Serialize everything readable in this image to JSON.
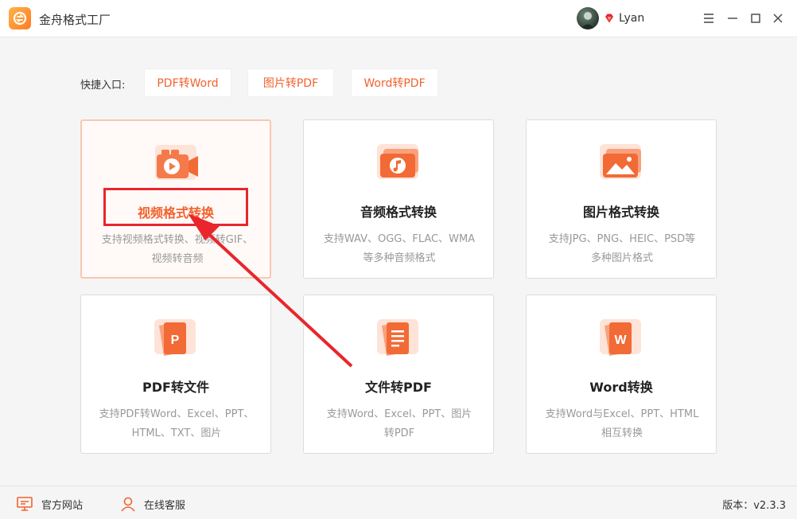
{
  "window": {
    "title": "金舟格式工厂",
    "user_name": "Lyan",
    "controls": [
      "menu-icon",
      "minimize-icon",
      "maximize-icon",
      "close-icon"
    ]
  },
  "quick_entry": {
    "label": "快捷入口:",
    "buttons": [
      "PDF转Word",
      "图片转PDF",
      "Word转PDF"
    ]
  },
  "cards": [
    {
      "title": "视频格式转换",
      "desc_line1": "支持视频格式转换、视频转GIF、",
      "desc_line2": "视频转音频",
      "icon": "video-icon",
      "selected": true
    },
    {
      "title": "音频格式转换",
      "desc_line1": "支持WAV、OGG、FLAC、WMA",
      "desc_line2": "等多种音频格式",
      "icon": "music-icon",
      "selected": false
    },
    {
      "title": "图片格式转换",
      "desc_line1": "支持JPG、PNG、HEIC、PSD等",
      "desc_line2": "多种图片格式",
      "icon": "image-icon",
      "selected": false
    },
    {
      "title": "PDF转文件",
      "desc_line1": "支持PDF转Word、Excel、PPT、",
      "desc_line2": "HTML、TXT、图片",
      "icon": "pdf-icon",
      "icon_letter": "P",
      "selected": false
    },
    {
      "title": "文件转PDF",
      "desc_line1": "支持Word、Excel、PPT、图片",
      "desc_line2": "转PDF",
      "icon": "document-icon",
      "selected": false
    },
    {
      "title": "Word转换",
      "desc_line1": "支持Word与Excel、PPT、HTML",
      "desc_line2": "相互转换",
      "icon": "word-icon",
      "icon_letter": "W",
      "selected": false
    }
  ],
  "footer": {
    "website": "官方网站",
    "support": "在线客服",
    "version": "版本：v2.3.3"
  },
  "colors": {
    "accent": "#f2622e",
    "highlight_box": "#e8262c",
    "arrow": "#e8262c"
  }
}
